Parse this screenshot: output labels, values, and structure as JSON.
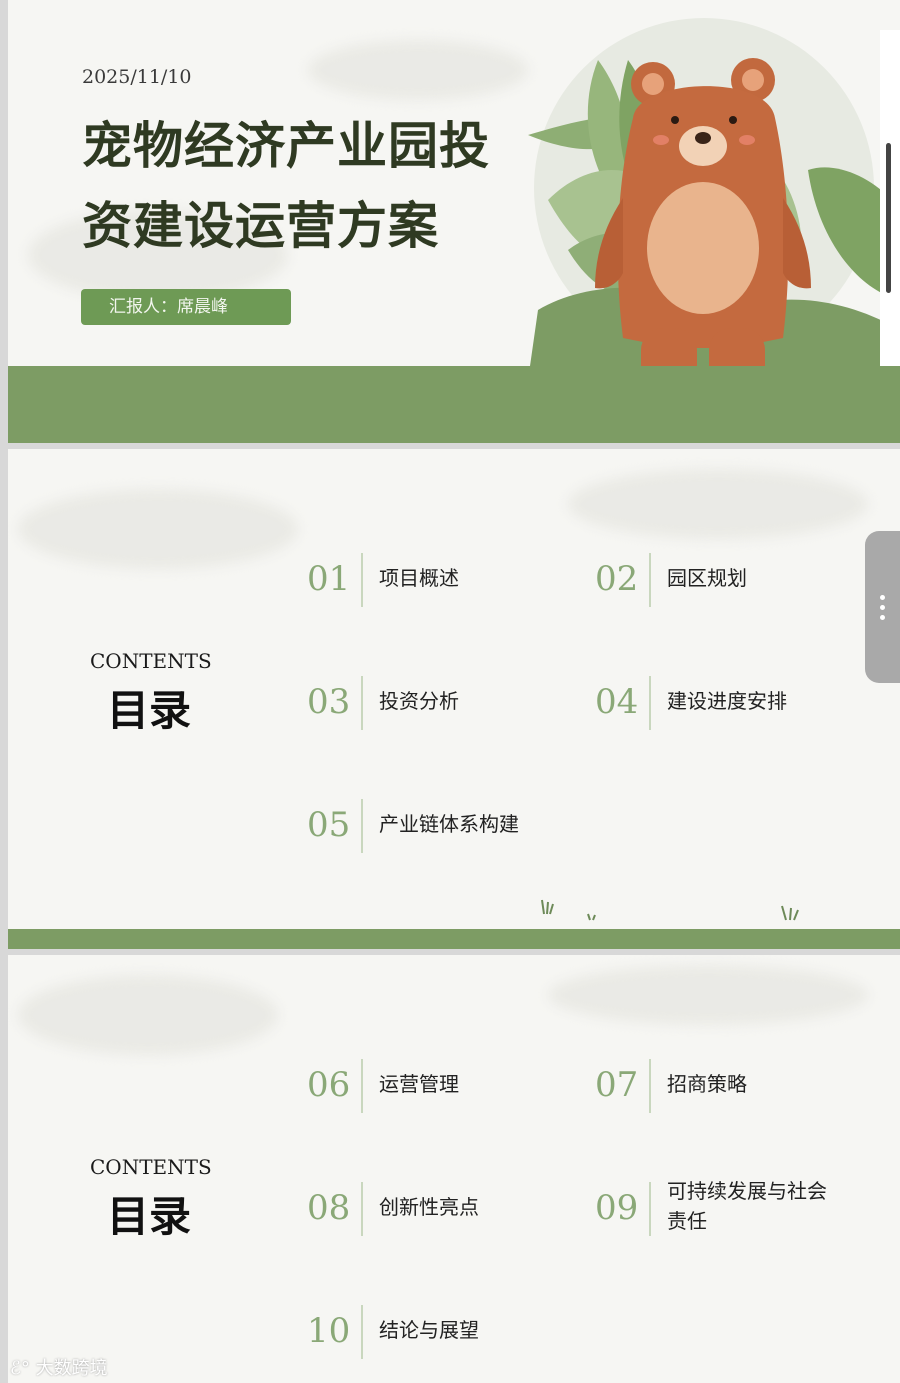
{
  "cover": {
    "date": "2025/11/10",
    "title_line1": "宠物经济产业园投",
    "title_line2": "资建设运营方案",
    "reporter": "汇报人：席晨峰"
  },
  "toc1": {
    "contents_label": "CONTENTS",
    "heading": "目录",
    "items": [
      {
        "num": "01",
        "label": "项目概述"
      },
      {
        "num": "02",
        "label": "园区规划"
      },
      {
        "num": "03",
        "label": "投资分析"
      },
      {
        "num": "04",
        "label": "建设进度安排"
      },
      {
        "num": "05",
        "label": "产业链体系构建"
      }
    ]
  },
  "toc2": {
    "contents_label": "CONTENTS",
    "heading": "目录",
    "items": [
      {
        "num": "06",
        "label": "运营管理"
      },
      {
        "num": "07",
        "label": "招商策略"
      },
      {
        "num": "08",
        "label": "创新性亮点"
      },
      {
        "num": "09",
        "label": "可持续发展与社会责任"
      },
      {
        "num": "10",
        "label": "结论与展望"
      }
    ]
  },
  "watermark": "大数跨境",
  "icons": {
    "bear": "bear-illustration",
    "leaves": "leaf-icon",
    "menu": "more-vertical-icon",
    "watermark_logo": "brand-logo-icon"
  },
  "colors": {
    "green_band": "#7d9c64",
    "green_button": "#6e9a55",
    "number": "#8aa877",
    "title": "#2f3a22"
  }
}
